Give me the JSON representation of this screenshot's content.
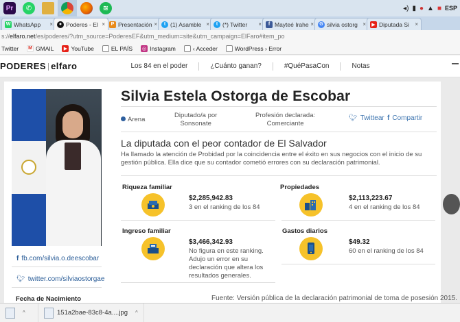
{
  "taskbar": {
    "apps": [
      {
        "name": "premiere",
        "label": "Pr",
        "color": "#2a0a4a"
      },
      {
        "name": "whatsapp",
        "label": "",
        "color": "#25d366"
      },
      {
        "name": "files",
        "label": "",
        "color": "#e0b040"
      },
      {
        "name": "chrome",
        "label": "",
        "color": "#db4437"
      },
      {
        "name": "firefox",
        "label": "",
        "color": "#e66000"
      },
      {
        "name": "spotify",
        "label": "",
        "color": "#1db954"
      }
    ],
    "tray_lang": "ESP"
  },
  "tabs": [
    {
      "label": "WhatsApp",
      "color": "#25d366",
      "glyph": "W"
    },
    {
      "label": "Poderes - El",
      "color": "#111111",
      "glyph": "●",
      "active": true
    },
    {
      "label": "Presentación",
      "color": "#e88a1a",
      "glyph": "P"
    },
    {
      "label": "(1) Asamble",
      "color": "#1da1f2",
      "glyph": "t"
    },
    {
      "label": "(*) Twitter",
      "color": "#1da1f2",
      "glyph": "t"
    },
    {
      "label": "Mayteé Irahe",
      "color": "#3b5998",
      "glyph": "f"
    },
    {
      "label": "silvia ostorg",
      "color": "#4285f4",
      "glyph": "G"
    },
    {
      "label": "Diputada Si",
      "color": "#e62117",
      "glyph": "▶"
    }
  ],
  "address": {
    "scheme": "s://",
    "host": "elfaro.net",
    "path": "/es/poderes/?utm_source=PoderesEF&utm_medium=site&utm_campaign=ElFaro#item_po"
  },
  "bookmarks": [
    {
      "label": "Twitter",
      "color": "",
      "glyph": ""
    },
    {
      "label": "GMAIL",
      "color": "#d93025",
      "glyph": "M"
    },
    {
      "label": "YouTube",
      "color": "#e62117",
      "glyph": "▶"
    },
    {
      "label": "EL PAÍS",
      "color": "#555555",
      "glyph": "□"
    },
    {
      "label": "Instagram",
      "color": "#c13584",
      "glyph": "◎"
    },
    {
      "label": "‹ Acceder",
      "color": "#888888",
      "glyph": "□"
    },
    {
      "label": "WordPress › Error",
      "color": "#888888",
      "glyph": "□"
    }
  ],
  "site": {
    "logo_left": "PODERES",
    "logo_right": "elfaro",
    "nav": [
      "Los 84 en el poder",
      "¿Cuánto ganan?",
      "#QuéPasaCon",
      "Notas"
    ]
  },
  "profile": {
    "name": "Silvia Estela Ostorga de Escobar",
    "party": "Arena",
    "district_label": "Diputado/a por",
    "district": "Sonsonate",
    "profession_label": "Profesión declarada:",
    "profession": "Comerciante",
    "twitter_share": "Twittear",
    "facebook_share": "Compartir",
    "facebook_link": "fb.com/silvia.o.deescobar",
    "twitter_link": "twitter.com/silviaostorgae",
    "birth_label": "Fecha de Nacimiento"
  },
  "article": {
    "subtitle": "La diputada con el peor contador de El Salvador",
    "lead": "Ha llamado la atención de Probidad por la coincidencia entre el éxito en sus negocios con el inicio de su gestión pública. Ella dice que su contador cometió errores con su declaración patrimonial."
  },
  "stats": [
    {
      "label": "Riqueza familiar",
      "value": "$2,285,942.83",
      "desc": "3 en el ranking de los 84",
      "icon": "money-stack-icon"
    },
    {
      "label": "Propiedades",
      "value": "$2,113,223.67",
      "desc": "4 en el ranking de los 84",
      "icon": "buildings-icon"
    },
    {
      "label": "Ingreso familiar",
      "value": "$3,466,342.93",
      "desc": "No figura en este ranking. Adujo un error en su declaración que altera los resultados generales.",
      "icon": "cash-register-icon"
    },
    {
      "label": "Gastos diarios",
      "value": "$49.32",
      "desc": "60 en el ranking de los 84",
      "icon": "phone-cart-icon"
    }
  ],
  "source": "Fuente: Versión pública de la declaración patrimonial de toma de posesión 2015.",
  "downloads": [
    {
      "label": ""
    },
    {
      "label": "151a2bae-83c8-4a....jpg"
    }
  ]
}
